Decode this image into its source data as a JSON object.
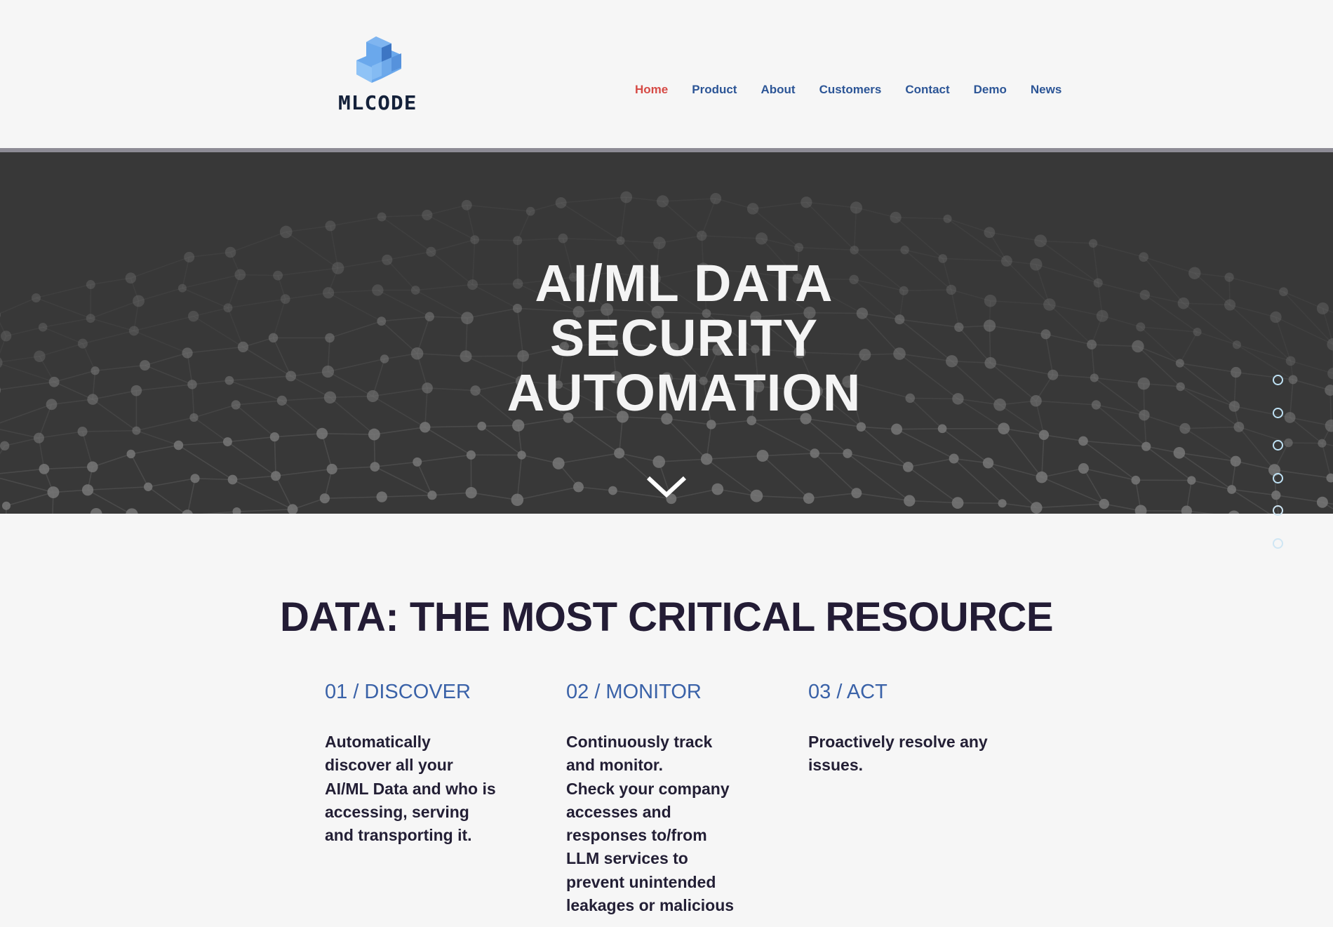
{
  "header": {
    "logo_text": "MLCODE",
    "logo_icon": "stacked-cubes-icon",
    "nav": [
      {
        "label": "Home",
        "active": true
      },
      {
        "label": "Product",
        "active": false
      },
      {
        "label": "About",
        "active": false
      },
      {
        "label": "Customers",
        "active": false
      },
      {
        "label": "Contact",
        "active": false
      },
      {
        "label": "Demo",
        "active": false
      },
      {
        "label": "News",
        "active": false
      }
    ]
  },
  "hero": {
    "title_lines": [
      "AI/ML DATA",
      "SECURITY",
      "AUTOMATION"
    ],
    "scroll_icon": "chevron-down-icon"
  },
  "page_nav_dots": {
    "count": 6
  },
  "section": {
    "title": "DATA: THE MOST CRITICAL RESOURCE",
    "columns": [
      {
        "heading": "01 / DISCOVER",
        "body": [
          "Automatically discover all your AI/ML Data and who is accessing, serving and transporting it."
        ]
      },
      {
        "heading": "02 / MONITOR",
        "body": [
          "Continuously track and monitor.",
          "Check your company accesses and responses to/from LLM services to prevent unintended leakages or malicious"
        ]
      },
      {
        "heading": "03 / ACT",
        "body": [
          "Proactively resolve any issues."
        ]
      }
    ]
  },
  "colors": {
    "nav_active": "#d64a45",
    "nav_link": "#2c5596",
    "heading_blue": "#3a62a8",
    "dark_text": "#231c35",
    "hero_bg": "#383838",
    "dot": "#bfe2f5"
  }
}
